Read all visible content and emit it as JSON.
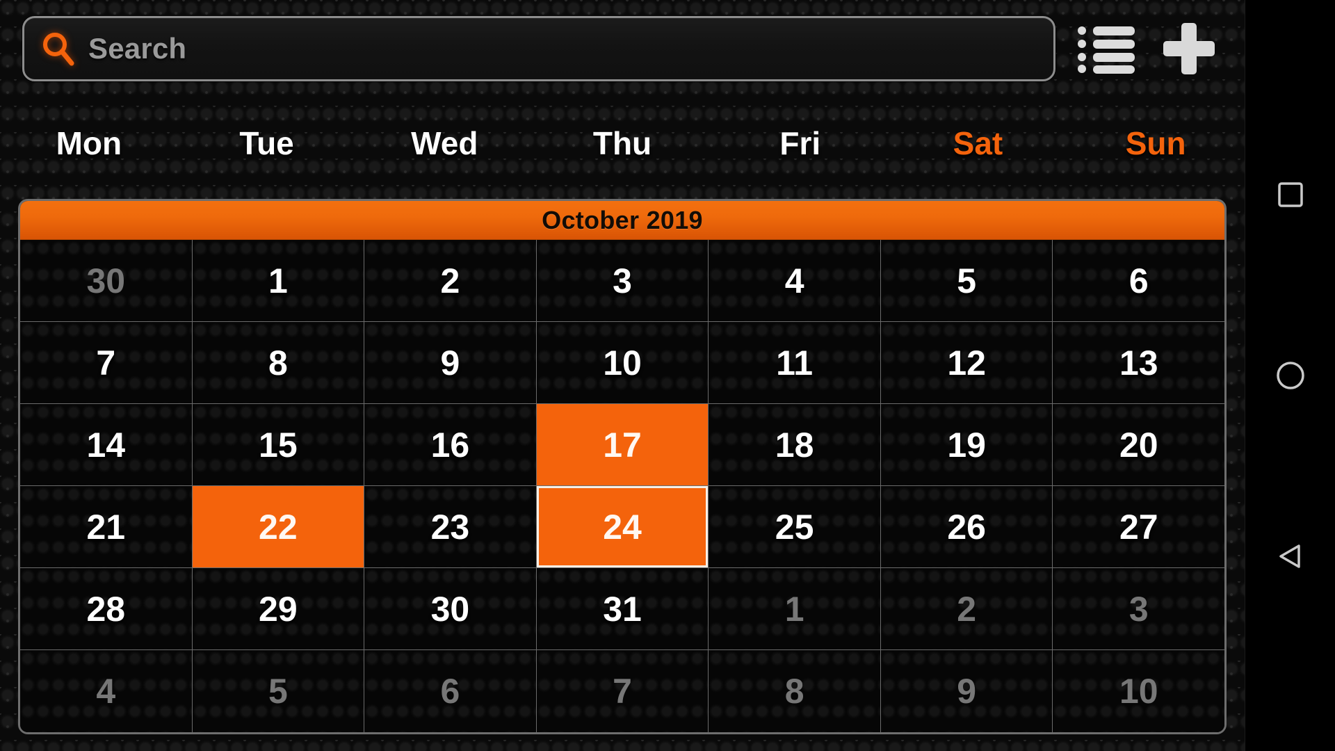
{
  "app": {
    "name": "Calendar",
    "accent_color": "#f4630c",
    "background_color": "#0b0b0b",
    "text_color": "#ffffff",
    "muted_text_color": "#777777"
  },
  "search": {
    "placeholder": "Search",
    "value": "",
    "icon": "search-icon"
  },
  "toolbar": {
    "list_view_icon": "list-view-icon",
    "add_event_icon": "plus-icon"
  },
  "weekdays": [
    {
      "label": "Mon",
      "weekend": false
    },
    {
      "label": "Tue",
      "weekend": false
    },
    {
      "label": "Wed",
      "weekend": false
    },
    {
      "label": "Thu",
      "weekend": false
    },
    {
      "label": "Fri",
      "weekend": false
    },
    {
      "label": "Sat",
      "weekend": true
    },
    {
      "label": "Sun",
      "weekend": true
    }
  ],
  "calendar": {
    "month_title": "October 2019",
    "month": "October",
    "year": "2019",
    "weeks": [
      [
        {
          "num": "30",
          "other": true,
          "state": "normal"
        },
        {
          "num": "1",
          "other": false,
          "state": "normal"
        },
        {
          "num": "2",
          "other": false,
          "state": "normal"
        },
        {
          "num": "3",
          "other": false,
          "state": "normal"
        },
        {
          "num": "4",
          "other": false,
          "state": "normal"
        },
        {
          "num": "5",
          "other": false,
          "state": "normal"
        },
        {
          "num": "6",
          "other": false,
          "state": "normal"
        }
      ],
      [
        {
          "num": "7",
          "other": false,
          "state": "normal"
        },
        {
          "num": "8",
          "other": false,
          "state": "normal"
        },
        {
          "num": "9",
          "other": false,
          "state": "normal"
        },
        {
          "num": "10",
          "other": false,
          "state": "normal"
        },
        {
          "num": "11",
          "other": false,
          "state": "normal"
        },
        {
          "num": "12",
          "other": false,
          "state": "normal"
        },
        {
          "num": "13",
          "other": false,
          "state": "normal"
        }
      ],
      [
        {
          "num": "14",
          "other": false,
          "state": "normal"
        },
        {
          "num": "15",
          "other": false,
          "state": "normal"
        },
        {
          "num": "16",
          "other": false,
          "state": "normal"
        },
        {
          "num": "17",
          "other": false,
          "state": "selected"
        },
        {
          "num": "18",
          "other": false,
          "state": "normal"
        },
        {
          "num": "19",
          "other": false,
          "state": "normal"
        },
        {
          "num": "20",
          "other": false,
          "state": "normal"
        }
      ],
      [
        {
          "num": "21",
          "other": false,
          "state": "normal"
        },
        {
          "num": "22",
          "other": false,
          "state": "selected"
        },
        {
          "num": "23",
          "other": false,
          "state": "normal"
        },
        {
          "num": "24",
          "other": false,
          "state": "today"
        },
        {
          "num": "25",
          "other": false,
          "state": "normal"
        },
        {
          "num": "26",
          "other": false,
          "state": "normal"
        },
        {
          "num": "27",
          "other": false,
          "state": "normal"
        }
      ],
      [
        {
          "num": "28",
          "other": false,
          "state": "normal"
        },
        {
          "num": "29",
          "other": false,
          "state": "normal"
        },
        {
          "num": "30",
          "other": false,
          "state": "normal"
        },
        {
          "num": "31",
          "other": false,
          "state": "normal"
        },
        {
          "num": "1",
          "other": true,
          "state": "normal"
        },
        {
          "num": "2",
          "other": true,
          "state": "normal"
        },
        {
          "num": "3",
          "other": true,
          "state": "normal"
        }
      ],
      [
        {
          "num": "4",
          "other": true,
          "state": "normal"
        },
        {
          "num": "5",
          "other": true,
          "state": "normal"
        },
        {
          "num": "6",
          "other": true,
          "state": "normal"
        },
        {
          "num": "7",
          "other": true,
          "state": "normal"
        },
        {
          "num": "8",
          "other": true,
          "state": "normal"
        },
        {
          "num": "9",
          "other": true,
          "state": "normal"
        },
        {
          "num": "10",
          "other": true,
          "state": "normal"
        }
      ]
    ]
  },
  "navbar": {
    "recents_icon": "square-recents-icon",
    "home_icon": "circle-home-icon",
    "back_icon": "triangle-back-icon"
  }
}
